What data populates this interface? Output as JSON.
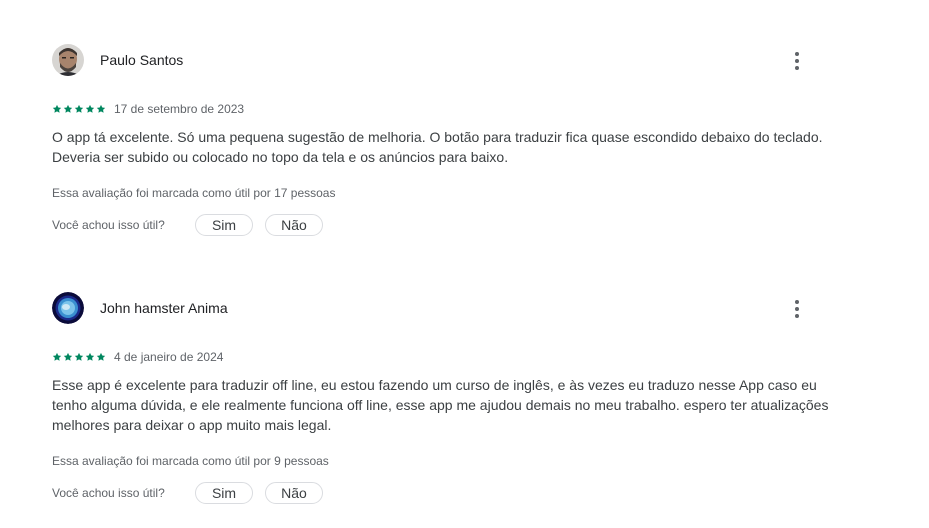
{
  "reviews": [
    {
      "author": "Paulo Santos",
      "rating": 5,
      "date": "17 de setembro de 2023",
      "text": "O app tá excelente. Só uma pequena sugestão de melhoria. O botão para traduzir fica quase escondido debaixo do teclado. Deveria ser subido ou colocado no topo da tela e os anúncios para baixo.",
      "helpful_count_text": "Essa avaliação foi marcada como útil por 17 pessoas",
      "helpful_question": "Você achou isso útil?",
      "yes_label": "Sim",
      "no_label": "Não"
    },
    {
      "author": "John hamster Anima",
      "rating": 5,
      "date": "4 de janeiro de 2024",
      "text": "Esse app é excelente para traduzir off line, eu estou fazendo um curso de inglês, e às vezes eu traduzo nesse App caso eu tenho alguma dúvida, e ele realmente funciona off line, esse app me ajudou demais no meu trabalho. espero ter atualizações melhores para deixar o app muito mais legal.",
      "helpful_count_text": "Essa avaliação foi marcada como útil por 9 pessoas",
      "helpful_question": "Você achou isso útil?",
      "yes_label": "Sim",
      "no_label": "Não"
    }
  ],
  "colors": {
    "star": "#01875f",
    "text_primary": "#202124",
    "text_secondary": "#5f6368",
    "pill_border": "#dadce0"
  },
  "icons": {
    "more": "more-vert-icon",
    "star": "star-icon"
  }
}
